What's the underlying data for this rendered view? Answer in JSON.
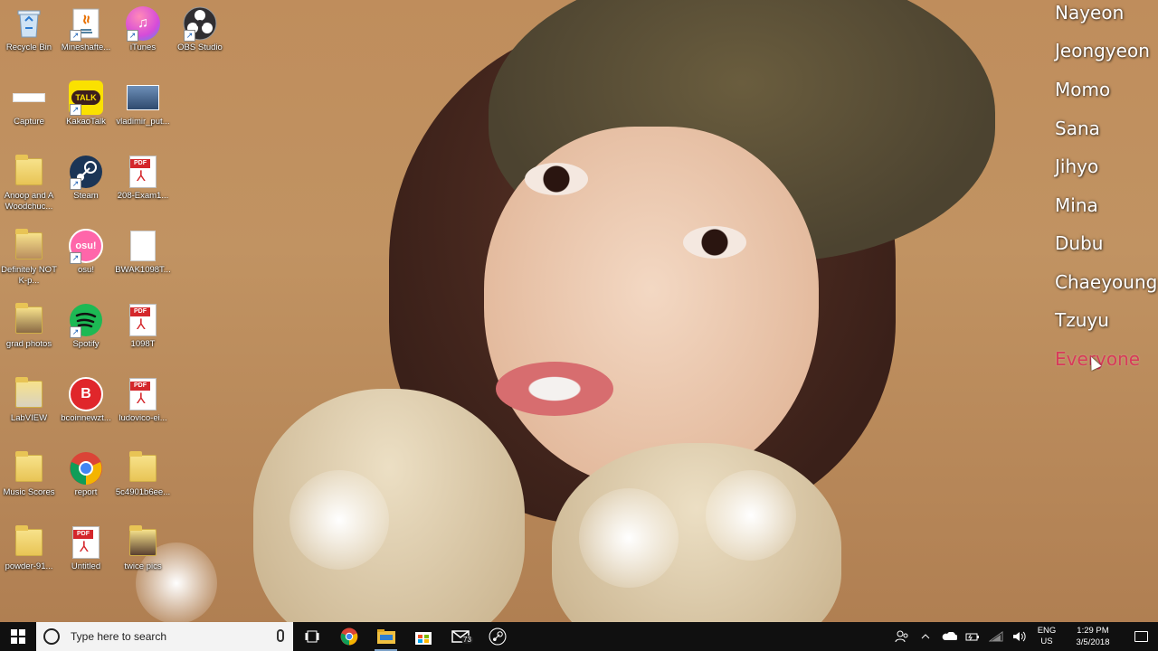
{
  "desktop": {
    "icons": [
      {
        "label": "Recycle Bin",
        "icon": "recycle-bin-icon"
      },
      {
        "label": "Mineshafte...",
        "icon": "java-app-icon"
      },
      {
        "label": "iTunes",
        "icon": "itunes-icon"
      },
      {
        "label": "OBS Studio",
        "icon": "obs-icon"
      },
      {
        "label": "Capture",
        "icon": "image-file-icon"
      },
      {
        "label": "KakaoTalk",
        "icon": "kakaotalk-icon",
        "badge": "TALK"
      },
      {
        "label": "vladimir_put...",
        "icon": "image-file-icon"
      },
      {
        "label": "Anoop and A Woodchuc...",
        "icon": "folder-icon"
      },
      {
        "label": "Steam",
        "icon": "steam-icon"
      },
      {
        "label": "208-Exam1...",
        "icon": "pdf-icon"
      },
      {
        "label": "Definitely NOT K-p...",
        "icon": "folder-icon"
      },
      {
        "label": "osu!",
        "icon": "osu-icon",
        "badge": "osu!"
      },
      {
        "label": "BWAK1098T...",
        "icon": "blank-file-icon"
      },
      {
        "label": "grad photos",
        "icon": "folder-icon"
      },
      {
        "label": "Spotify",
        "icon": "spotify-icon"
      },
      {
        "label": "1098T",
        "icon": "pdf-icon"
      },
      {
        "label": "LabVIEW",
        "icon": "folder-icon"
      },
      {
        "label": "bcoinnewzt...",
        "icon": "bitdefender-icon",
        "badge": "B"
      },
      {
        "label": "ludovico-ei...",
        "icon": "pdf-icon"
      },
      {
        "label": "Music Scores",
        "icon": "folder-icon"
      },
      {
        "label": "report",
        "icon": "chrome-icon"
      },
      {
        "label": "5c4901b6ee...",
        "icon": "folder-icon"
      },
      {
        "label": "powder-91...",
        "icon": "folder-icon"
      },
      {
        "label": "Untitled",
        "icon": "pdf-icon"
      },
      {
        "label": "twice pics",
        "icon": "folder-icon"
      }
    ],
    "pdf_badge": "PDF"
  },
  "name_menu": {
    "items": [
      "Nayeon",
      "Jeongyeon",
      "Momo",
      "Sana",
      "Jihyo",
      "Mina",
      "Dubu",
      "Chaeyoung",
      "Tzuyu",
      "Everyone"
    ],
    "active": "Everyone",
    "active_color": "#d83a5a"
  },
  "taskbar": {
    "search_placeholder": "Type here to search",
    "pinned": [
      "task-view-icon",
      "chrome-icon",
      "file-explorer-icon",
      "store-icon",
      "mail-icon",
      "steam-taskbar-icon"
    ],
    "mail_badge": "73",
    "tray": {
      "lang_top": "ENG",
      "lang_bottom": "US",
      "time": "1:29 PM",
      "date": "3/5/2018"
    }
  },
  "colors": {
    "taskbar_bg": "#101010",
    "search_bg": "#f3f3f3"
  }
}
